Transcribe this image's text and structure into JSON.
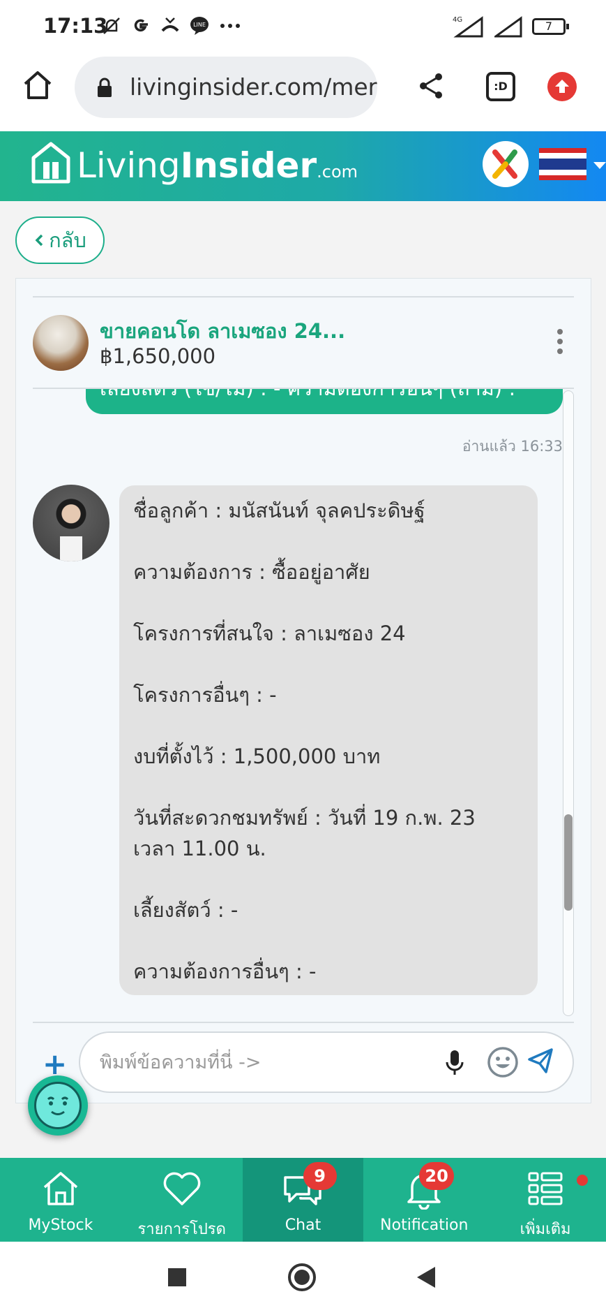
{
  "status_bar": {
    "time": "17:13",
    "network": "4G",
    "battery": "7",
    "icons": [
      "alarm-off-icon",
      "google-icon",
      "missed-call-icon",
      "line-icon",
      "more-icon",
      "signal-icon",
      "signal-icon",
      "battery-icon"
    ]
  },
  "browser": {
    "url": "livinginsider.com/mer",
    "tab_label": ":D"
  },
  "header": {
    "logo_living": "Living",
    "logo_insider": "Insider",
    "logo_com": ".com"
  },
  "back_button": {
    "label": "กลับ"
  },
  "property": {
    "title": "ขายคอนโด ลาเมซอง 24...",
    "price": "฿1,650,000"
  },
  "chat": {
    "sent_message_partial": "เลี้ยงสัตว์ (ใช่/ไม่) : - ความต้องการอื่นๆ (ถ้ามี) :",
    "read_status": "อ่านแล้ว  16:33",
    "received_message": [
      "ชื่อลูกค้า : มนัสนันท์ จุลคประดิษฐ์",
      "ความต้องการ : ซื้ออยู่อาศัย",
      "โครงการที่สนใจ : ลาเมซอง 24",
      "โครงการอื่นๆ : -",
      "งบที่ตั้งไว้ : 1,500,000 บาท",
      "วันที่สะดวกชมทรัพย์ : วันที่ 19 ก.พ. 23 เวลา 11.00 น.",
      "เลี้ยงสัตว์ : -",
      "ความต้องการอื่นๆ : -"
    ],
    "input_placeholder": "พิมพ์ข้อความที่นี่ ->",
    "input_value": ""
  },
  "bottom_nav": [
    {
      "label": "MyStock",
      "icon": "home-icon"
    },
    {
      "label": "รายการโปรด",
      "icon": "heart-icon"
    },
    {
      "label": "Chat",
      "icon": "chat-icon",
      "badge": "9",
      "active": true
    },
    {
      "label": "Notification",
      "icon": "bell-icon",
      "badge": "20"
    },
    {
      "label": "เพิ่มเติม",
      "icon": "menu-grid-icon"
    }
  ],
  "colors": {
    "brand_green": "#1eb38e",
    "active_nav": "#14957a",
    "badge_red": "#e53935",
    "sent_bubble": "#1cb389",
    "received_bubble": "#e2e2e2"
  }
}
